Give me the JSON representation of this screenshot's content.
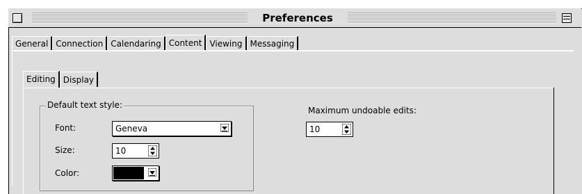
{
  "window": {
    "title": "Preferences"
  },
  "tabs": [
    "General",
    "Connection",
    "Calendaring",
    "Content",
    "Viewing",
    "Messaging"
  ],
  "active_tab": "Content",
  "subtabs": [
    "Editing",
    "Display"
  ],
  "active_subtab": "Editing",
  "editing": {
    "group_label": "Default text style:",
    "font_label": "Font:",
    "font_value": "Geneva",
    "size_label": "Size:",
    "size_value": "10",
    "color_label": "Color:",
    "color_value": "#000000",
    "undo_label": "Maximum undoable edits:",
    "undo_value": "10"
  }
}
